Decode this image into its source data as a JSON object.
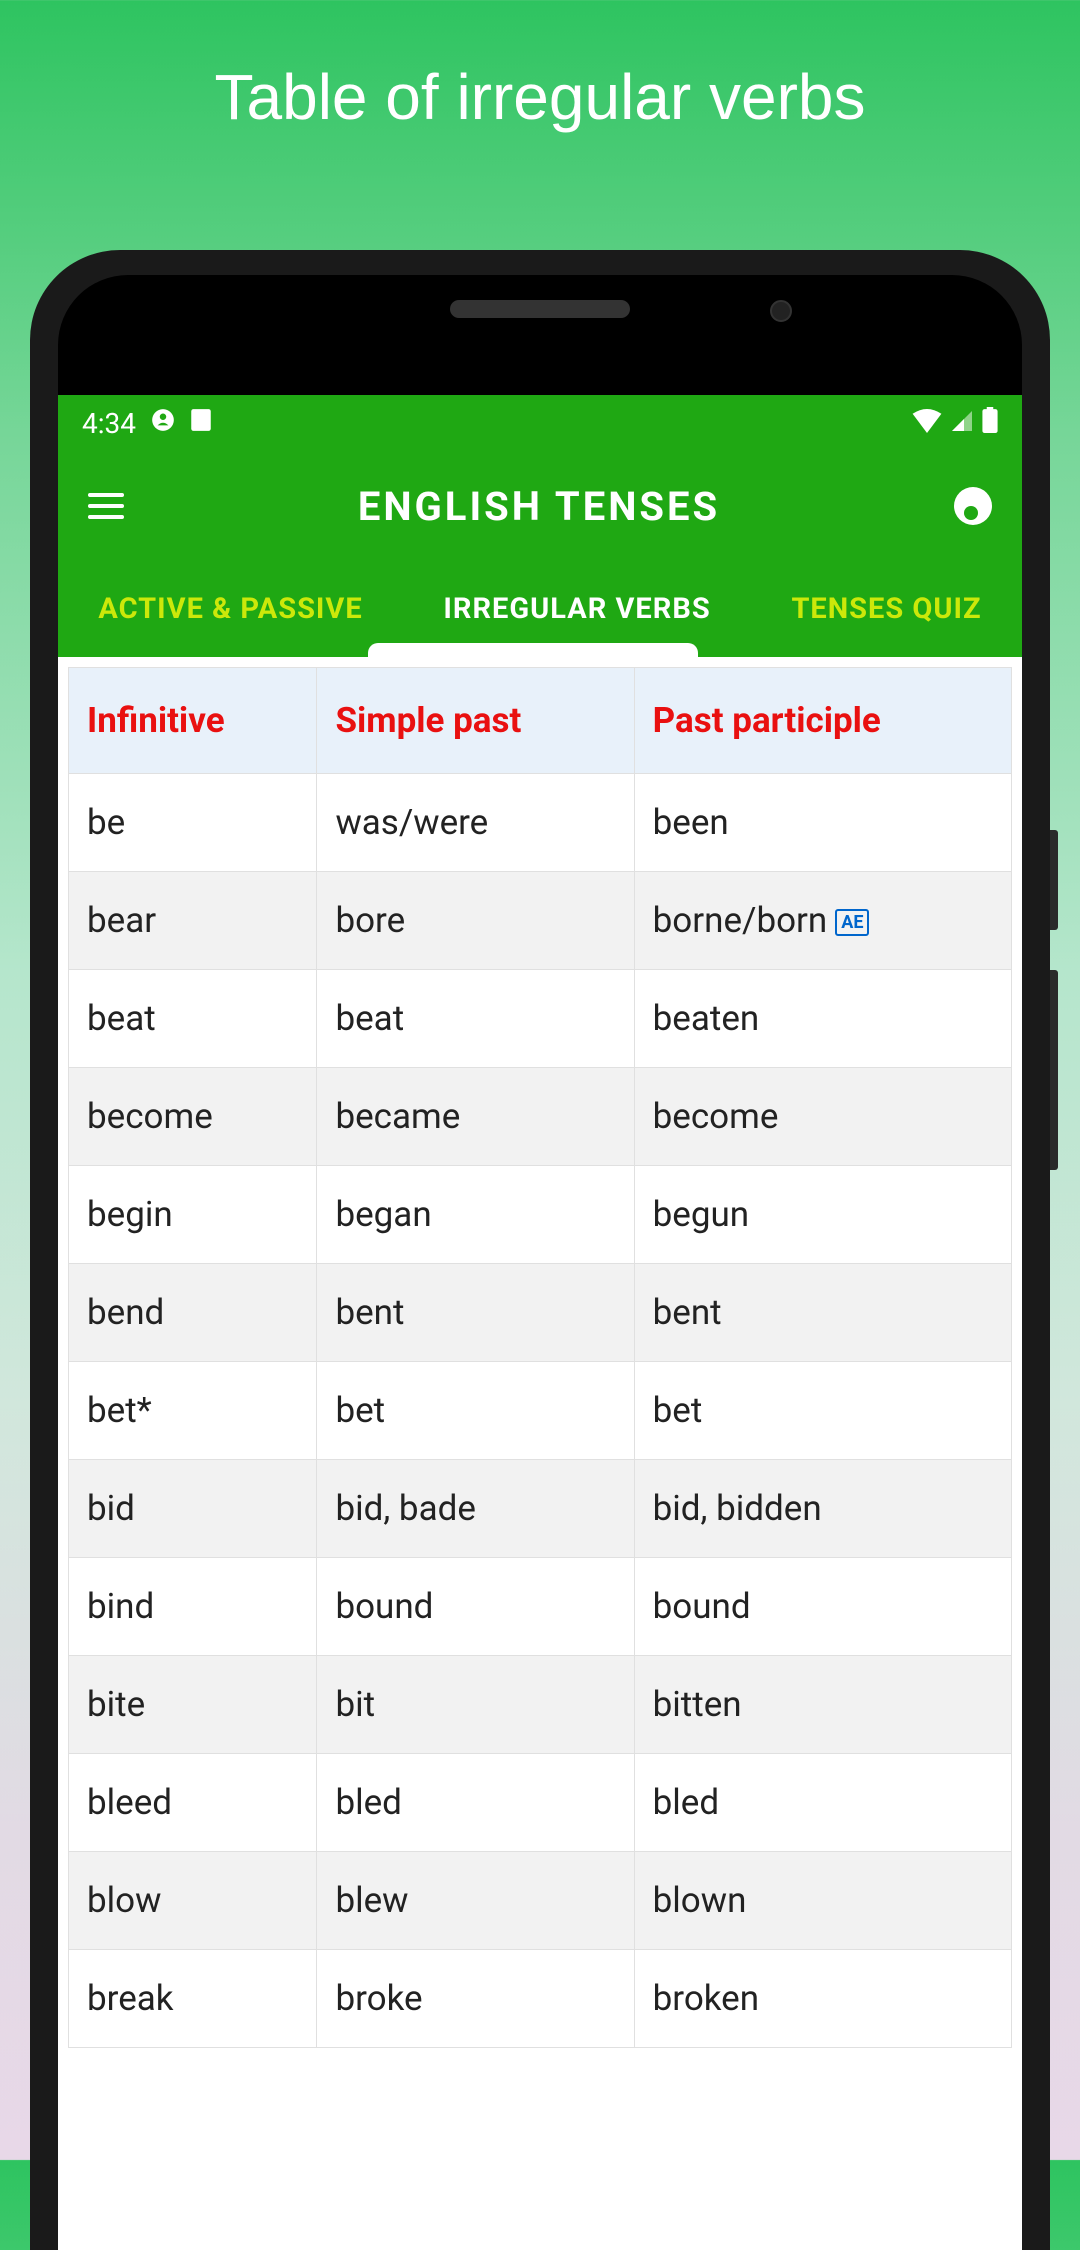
{
  "promo": {
    "title": "Table of irregular verbs"
  },
  "status": {
    "time": "4:34"
  },
  "app": {
    "title": "ENGLISH TENSES"
  },
  "tabs": {
    "items": [
      {
        "label": "ACTIVE & PASSIVE"
      },
      {
        "label": "IRREGULAR VERBS"
      },
      {
        "label": "TENSES QUIZ"
      }
    ]
  },
  "table": {
    "headers": [
      "Infinitive",
      "Simple past",
      "Past participle"
    ],
    "rows": [
      {
        "infinitive": "be",
        "past": "was/were",
        "participle": "been"
      },
      {
        "infinitive": "bear",
        "past": "bore",
        "participle": "borne/born",
        "badge": "AE"
      },
      {
        "infinitive": "beat",
        "past": "beat",
        "participle": "beaten"
      },
      {
        "infinitive": "become",
        "past": "became",
        "participle": "become"
      },
      {
        "infinitive": "begin",
        "past": "began",
        "participle": "begun"
      },
      {
        "infinitive": "bend",
        "past": "bent",
        "participle": "bent"
      },
      {
        "infinitive": "bet*",
        "past": "bet",
        "participle": "bet"
      },
      {
        "infinitive": "bid",
        "past": "bid, bade",
        "participle": "bid, bidden"
      },
      {
        "infinitive": "bind",
        "past": "bound",
        "participle": "bound"
      },
      {
        "infinitive": "bite",
        "past": "bit",
        "participle": "bitten"
      },
      {
        "infinitive": "bleed",
        "past": "bled",
        "participle": "bled"
      },
      {
        "infinitive": "blow",
        "past": "blew",
        "participle": "blown"
      },
      {
        "infinitive": "break",
        "past": "broke",
        "participle": "broken"
      }
    ]
  }
}
